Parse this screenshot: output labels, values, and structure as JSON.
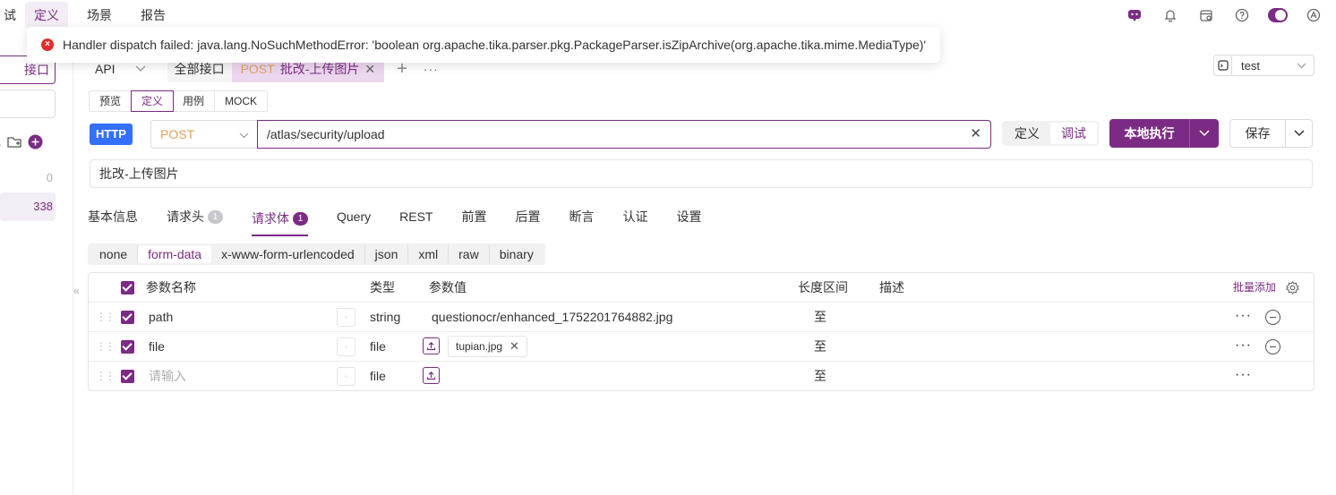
{
  "topnav": {
    "items": [
      "试",
      "定义",
      "场景",
      "报告"
    ],
    "active_index": 1
  },
  "toast": {
    "message": "Handler dispatch failed: java.lang.NoSuchMethodError: 'boolean org.apache.tika.parser.pkg.PackageParser.isZipArchive(org.apache.tika.mime.MediaType)'"
  },
  "sidebar": {
    "new_button": "接口",
    "count_a": "0",
    "count_b": "338"
  },
  "tabs": {
    "api_label": "API",
    "all_label": "全部接口",
    "current_method": "POST",
    "current_name": "批改-上传图片"
  },
  "env": {
    "value": "test"
  },
  "modetabs": [
    "预览",
    "定义",
    "用例",
    "MOCK"
  ],
  "request": {
    "protocol": "HTTP",
    "method": "POST",
    "url": "/atlas/security/upload",
    "seg_define": "定义",
    "seg_debug": "调试",
    "run_label": "本地执行",
    "save_label": "保存",
    "name": "批改-上传图片"
  },
  "section_tabs": [
    {
      "label": "基本信息",
      "count": ""
    },
    {
      "label": "请求头",
      "count": "1"
    },
    {
      "label": "请求体",
      "count": "1"
    },
    {
      "label": "Query",
      "count": ""
    },
    {
      "label": "REST",
      "count": ""
    },
    {
      "label": "前置",
      "count": ""
    },
    {
      "label": "后置",
      "count": ""
    },
    {
      "label": "断言",
      "count": ""
    },
    {
      "label": "认证",
      "count": ""
    },
    {
      "label": "设置",
      "count": ""
    }
  ],
  "body_types": [
    "none",
    "form-data",
    "x-www-form-urlencoded",
    "json",
    "xml",
    "raw",
    "binary"
  ],
  "table": {
    "headers": {
      "name": "参数名称",
      "type": "类型",
      "value": "参数值",
      "length": "长度区间",
      "desc": "描述",
      "batch": "批量添加"
    },
    "rows": [
      {
        "name": "path",
        "type": "string",
        "value": "questionocr/enhanced_1752201764882.jpg",
        "range": "至"
      },
      {
        "name": "file",
        "type": "file",
        "value": "tupian.jpg",
        "range": "至"
      },
      {
        "name": "请输入",
        "type": "file",
        "value": "",
        "range": "至"
      }
    ]
  },
  "colors": {
    "accent": "#7b2b84",
    "http_badge": "#3370ff",
    "method": "#e2a05a",
    "error": "#e02e2e"
  }
}
